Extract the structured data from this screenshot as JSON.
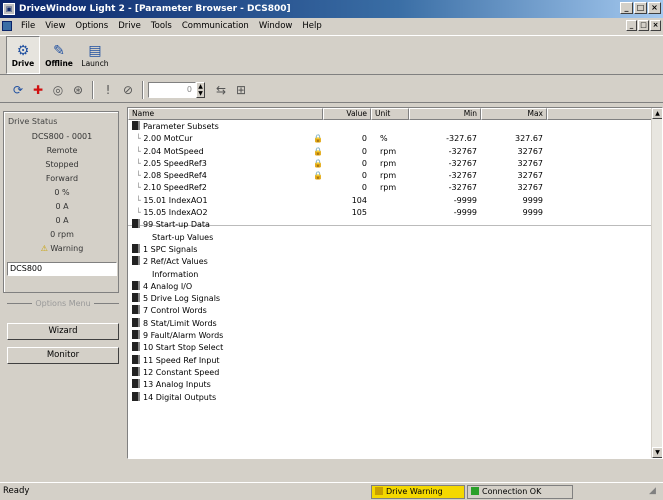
{
  "window": {
    "title": "DriveWindow Light 2 - [Parameter Browser - DCS800]",
    "controls": [
      "_",
      "□",
      "×"
    ]
  },
  "menu": {
    "items": [
      "File",
      "View",
      "Options",
      "Drive",
      "Tools",
      "Communication",
      "Window",
      "Help"
    ],
    "mdi_controls": [
      "_",
      "□",
      "×"
    ]
  },
  "bigtools": [
    {
      "label": "Drive",
      "icon": "drive-icon",
      "pressed": true
    },
    {
      "label": "Offline",
      "icon": "offline-icon",
      "pressed": false
    },
    {
      "label": "Launch",
      "icon": "launch-icon",
      "pressed": false
    }
  ],
  "toolbar": {
    "value_field": "0",
    "icons": [
      "refresh-icon",
      "add-icon",
      "up-icon",
      "settings-icon",
      "info-icon",
      "reset-icon",
      "compare-icon",
      "graph-icon"
    ]
  },
  "drive_status": {
    "title": "Drive Status",
    "lines": [
      "DCS800 - 0001",
      "Remote",
      "Stopped",
      "Forward",
      "0 %",
      "0 A",
      "0 A",
      "0 rpm"
    ],
    "warning": "Warning",
    "value": "DCS800"
  },
  "options_label": "Options Menu",
  "buttons": {
    "wizard": "Wizard",
    "monitor": "Monitor"
  },
  "columns": [
    "Name",
    "Value",
    "Unit",
    "Min",
    "Max"
  ],
  "params": [
    {
      "name": "Parameter Subsets",
      "type": "root"
    },
    {
      "name": "2.00 MotCur",
      "value": "0",
      "unit": "%",
      "min": "-327.67",
      "max": "327.67",
      "lock": true
    },
    {
      "name": "2.04 MotSpeed",
      "value": "0",
      "unit": "rpm",
      "min": "-32767",
      "max": "32767",
      "lock": true
    },
    {
      "name": "2.05 SpeedRef3",
      "value": "0",
      "unit": "rpm",
      "min": "-32767",
      "max": "32767",
      "lock": true
    },
    {
      "name": "2.08 SpeedRef4",
      "value": "0",
      "unit": "rpm",
      "min": "-32767",
      "max": "32767",
      "lock": true
    },
    {
      "name": "2.10 SpeedRef2",
      "value": "0",
      "unit": "rpm",
      "min": "-32767",
      "max": "32767",
      "lock": false
    },
    {
      "name": "15.01 IndexAO1",
      "value": "104",
      "unit": "",
      "min": "-9999",
      "max": "9999",
      "lock": false
    },
    {
      "name": "15.05 IndexAO2",
      "value": "105",
      "unit": "",
      "min": "-9999",
      "max": "9999",
      "lock": false
    },
    {
      "name": "99 Start-up Data",
      "type": "group"
    },
    {
      "name": "Start-up Values",
      "type": "sub"
    },
    {
      "name": "1 SPC Signals",
      "type": "group"
    },
    {
      "name": "2 Ref/Act Values",
      "type": "group"
    },
    {
      "name": "Information",
      "type": "sub"
    },
    {
      "name": "4 Analog I/O",
      "type": "group"
    },
    {
      "name": "5 Drive Log Signals",
      "type": "group"
    },
    {
      "name": "7 Control Words",
      "type": "group"
    },
    {
      "name": "8 Stat/Limit Words",
      "type": "group"
    },
    {
      "name": "9 Fault/Alarm Words",
      "type": "group"
    },
    {
      "name": "10 Start Stop Select",
      "type": "group"
    },
    {
      "name": "11 Speed Ref Input",
      "type": "group"
    },
    {
      "name": "12 Constant Speed",
      "type": "group"
    },
    {
      "name": "13 Analog Inputs",
      "type": "group"
    },
    {
      "name": "14 Digital Outputs",
      "type": "group"
    }
  ],
  "status": {
    "ready": "Ready",
    "warning": "Drive Warning",
    "comm": "Connection OK",
    "warning_color": "#f4d800",
    "comm_color": "#2aa02a"
  }
}
